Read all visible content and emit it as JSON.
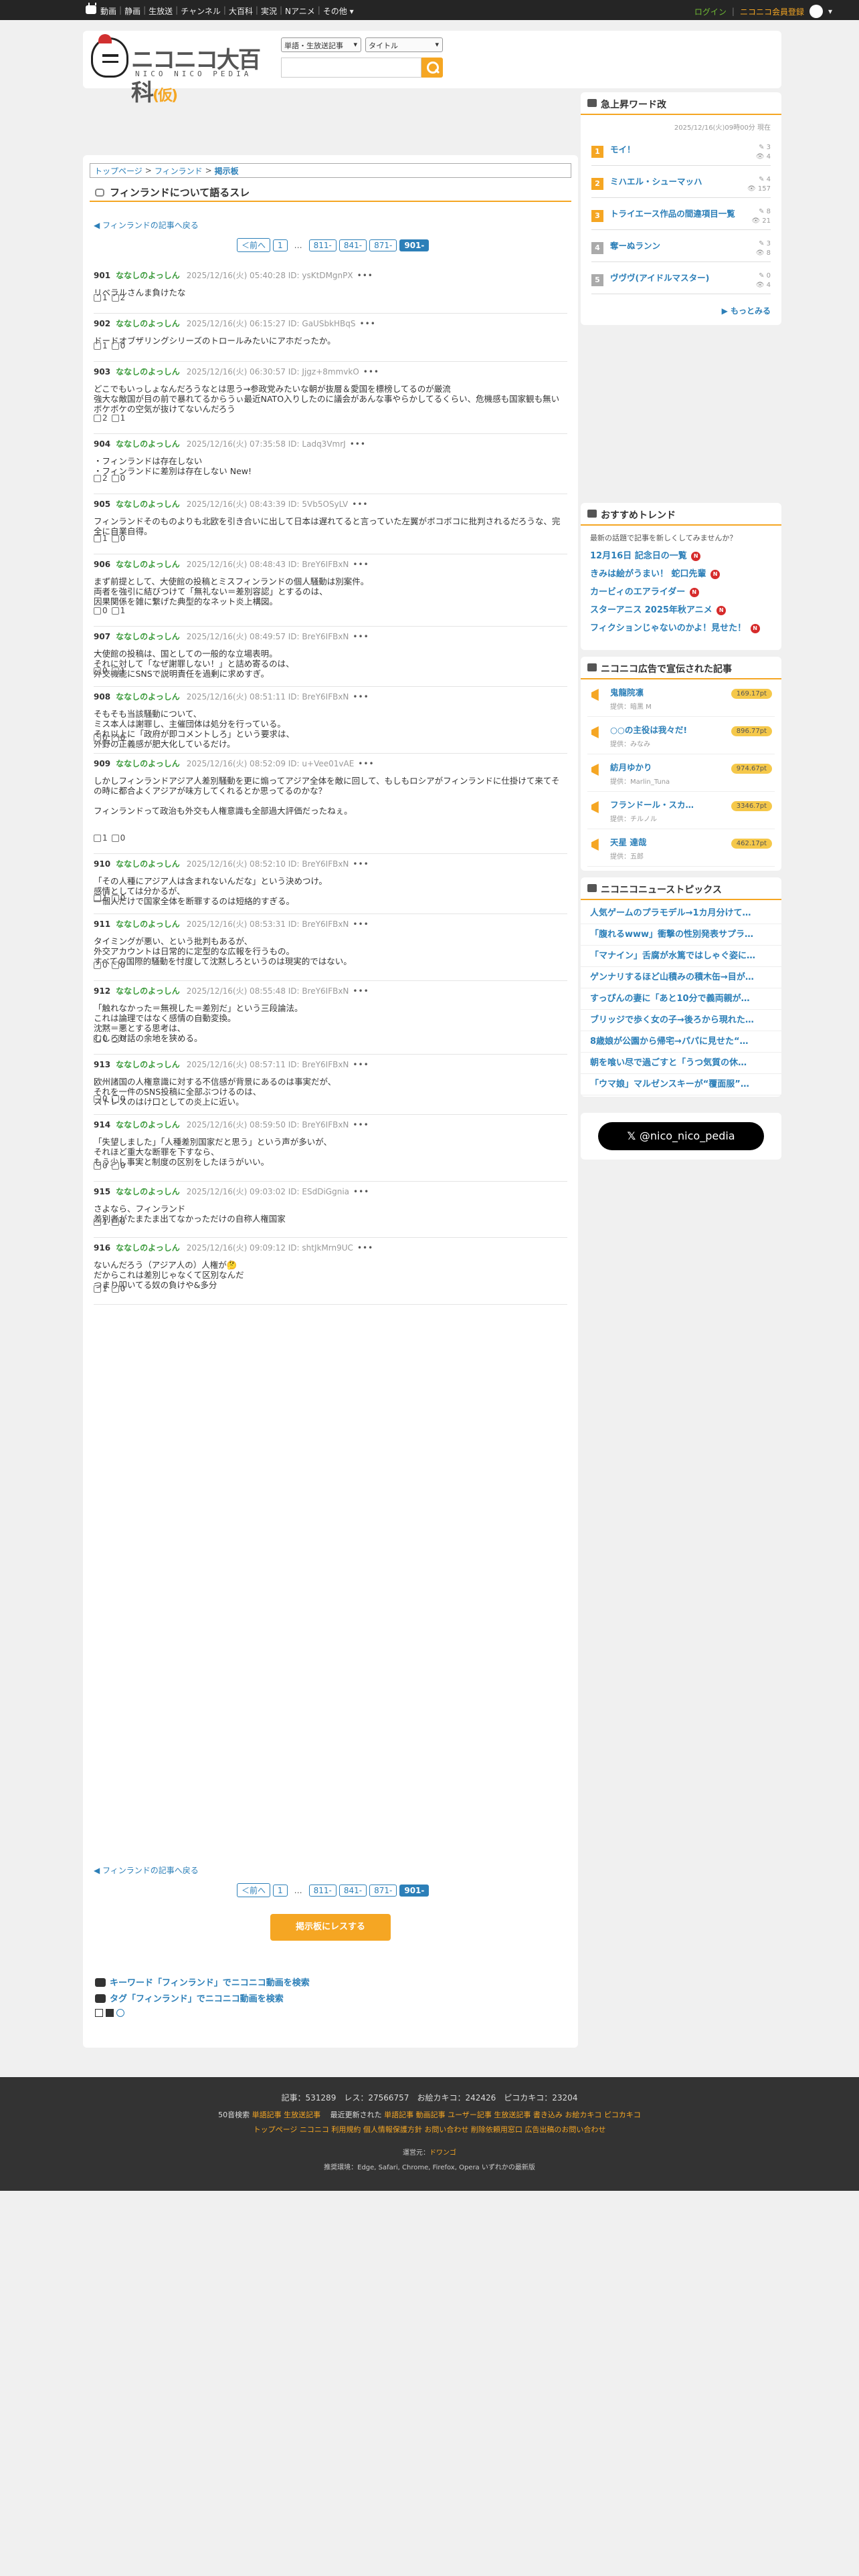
{
  "topbar": {
    "nav": [
      "動画",
      "静画",
      "生放送",
      "チャンネル",
      "大百科",
      "実況",
      "Nアニメ",
      "その他 ▾"
    ],
    "login": "ログイン",
    "register": "ニコニコ会員登録"
  },
  "header": {
    "logo_title": "ニコニコ大百科",
    "logo_badge": "(仮)",
    "logo_sub": "NICO NICO PEDIA",
    "search_type": "単語・生放送記事",
    "search_target": "タイトル",
    "search_placeholder": ""
  },
  "breadcrumb": [
    "トップページ",
    "フィンランド",
    "掲示板"
  ],
  "page_title": "フィンランドについて語るスレ",
  "back_link": "フィンランドの記事へ戻る",
  "pager": [
    "＜前へ",
    "1",
    "…",
    "811-",
    "841-",
    "871-",
    "901-"
  ],
  "posts": [
    {
      "no": "901",
      "name": "ななしのよっしん",
      "meta": "2025/12/16(火) 05:40:28 ID: ysKtDMgnPX",
      "body": "リベラルさんま負けたな",
      "good": "1",
      "bad": "2"
    },
    {
      "no": "902",
      "name": "ななしのよっしん",
      "meta": "2025/12/16(火) 06:15:27 ID: GaUSbkHBqS",
      "body": "ドードオブザリングシリーズのトロールみたいにアホだったか。",
      "good": "1",
      "bad": "0"
    },
    {
      "no": "903",
      "name": "ななしのよっしん",
      "meta": "2025/12/16(火) 06:30:57 ID: Jjgz+8mmvkO",
      "body": "どこでもいっしょなんだろうなとは思う→参政党みたいな朝が抜層＆愛国を標榜してるのが厳流\n強大な敵国が目の前で暴れてるからうぃ最近NATO入りしたのに議会があんな事やらかしてるくらい、危機感も国家観も無いボケボケの空気が抜けてないんだろう",
      "good": "2",
      "bad": "1"
    },
    {
      "no": "904",
      "name": "ななしのよっしん",
      "meta": "2025/12/16(火) 07:35:58 ID: Ladq3VmrJ",
      "body": "・フィンランドは存在しない\n・フィンランドに差別は存在しない New!",
      "good": "2",
      "bad": "0"
    },
    {
      "no": "905",
      "name": "ななしのよっしん",
      "meta": "2025/12/16(火) 08:43:39 ID: 5Vb5OSyLV",
      "body": "フィンランドそのものよりも北欧を引き合いに出して日本は遅れてると言っていた左翼がボコボコに批判されるだろうな、完全に自業自得。",
      "good": "1",
      "bad": "0"
    },
    {
      "no": "906",
      "name": "ななしのよっしん",
      "meta": "2025/12/16(火) 08:48:43 ID: BreY6IFBxN",
      "body": "まず前提として、大使館の投稿とミスフィンランドの個人騒動は別案件。\n両者を強引に結びつけて「無礼ない＝差別容認」とするのは、\n因果関係を雑に繋げた典型的なネット炎上構図。",
      "good": "0",
      "bad": "1"
    },
    {
      "no": "907",
      "name": "ななしのよっしん",
      "meta": "2025/12/16(火) 08:49:57 ID: BreY6IFBxN",
      "body": "大使館の投稿は、国としての一般的な立場表明。\nそれに対して「なぜ謝罪しない！」と詰め寄るのは、\n外交機能にSNSで説明責任を過剰に求めすぎ。",
      "good": "0",
      "bad": "1"
    },
    {
      "no": "908",
      "name": "ななしのよっしん",
      "meta": "2025/12/16(火) 08:51:11 ID: BreY6IFBxN",
      "body": "そもそも当該騒動について、\nミス本人は謝罪し、主催団体は処分を行っている。\nそれ以上に「政府が即コメントしろ」という要求は、\n外野の正義感が肥大化しているだけ。",
      "good": "0",
      "bad": "0"
    },
    {
      "no": "909",
      "name": "ななしのよっしん",
      "meta": "2025/12/16(火) 08:52:09 ID: u+Vee01vAE",
      "body": "しかしフィンランドアジア人差別騒動を更に煽ってアジア全体を敵に回して、もしもロシアがフィンランドに仕掛けて来てその時に都合よくアジアが味方してくれるとか思ってるのかな？\n\nフィンランドって政治も外交も人権意識も全部過大評価だったねぇ。",
      "good": "1",
      "bad": "0"
    },
    {
      "no": "910",
      "name": "ななしのよっしん",
      "meta": "2025/12/16(火) 08:52:10 ID: BreY6IFBxN",
      "body": "「その人種にアジア人は含まれないんだな」という決めつけ。\n感情としては分かるが、\n一個人だけで国家全体を断罪するのは短絡的すぎる。",
      "good": "1",
      "bad": "0"
    },
    {
      "no": "911",
      "name": "ななしのよっしん",
      "meta": "2025/12/16(火) 08:53:31 ID: BreY6IFBxN",
      "body": "タイミングが悪い、という批判もあるが、\n外交アカウントは日常的に定型的な広報を行うもの。\nすべての国際的騒動を忖度して沈黙しろというのは現実的ではない。",
      "good": "0",
      "bad": "0"
    },
    {
      "no": "912",
      "name": "ななしのよっしん",
      "meta": "2025/12/16(火) 08:55:48 ID: BreY6IFBxN",
      "body": "「触れなかった＝無視した＝差別だ」という三段論法。\nこれは論理ではなく感情の自動変換。\n沈黙＝悪とする思考は、\nむしろ対話の余地を狭める。",
      "good": "0",
      "bad": "0"
    },
    {
      "no": "913",
      "name": "ななしのよっしん",
      "meta": "2025/12/16(火) 08:57:11 ID: BreY6IFBxN",
      "body": "欧州諸国の人権意識に対する不信感が背景にあるのは事実だが、\nそれを一件のSNS投稿に全部ぶつけるのは、\nストレスのはけ口としての炎上に近い。",
      "good": "0",
      "bad": "0"
    },
    {
      "no": "914",
      "name": "ななしのよっしん",
      "meta": "2025/12/16(火) 08:59:50 ID: BreY6IFBxN",
      "body": "「失望しました」「人種差別国家だと思う」という声が多いが、\nそれほど重大な断罪を下すなら、\nもう少し事実と制度の区別をしたほうがいい。",
      "good": "0",
      "bad": "0"
    },
    {
      "no": "915",
      "name": "ななしのよっしん",
      "meta": "2025/12/16(火) 09:03:02 ID: ESdDiGgnia",
      "body": "さよなら、フィンランド\n差別者がたまたま出てなかっただけの自称人権国家",
      "good": "1",
      "bad": "0"
    },
    {
      "no": "916",
      "name": "ななしのよっしん",
      "meta": "2025/12/16(火) 09:09:12 ID: shtJkMrn9UC",
      "body": "ないんだろう（アジア人の）人権が🤔\nだからこれは差別じゃなくて区別なんだ\nつまり叩いてる奴の負けや&多分",
      "good": "1",
      "bad": "0"
    }
  ],
  "display_button": "掲示板にレスする",
  "keyword_links": [
    "キーワード「フィンランド」でニコニコ動画を検索",
    "タグ「フィンランド」でニコニコ動画を検索"
  ],
  "sidebar": {
    "rising_title": "急上昇ワード改",
    "rising_date": "2025/12/16(火)09時00分 現在",
    "rising": [
      {
        "no": "1",
        "title": "モイ！",
        "c1": "3",
        "c2": "4"
      },
      {
        "no": "2",
        "title": "ミハエル・シューマッハ",
        "c1": "4",
        "c2": "157"
      },
      {
        "no": "3",
        "title": "トライエース作品の間違項目一覧",
        "c1": "8",
        "c2": "21"
      },
      {
        "no": "4",
        "title": "奪ーぬランン",
        "c1": "3",
        "c2": "8"
      },
      {
        "no": "5",
        "title": "ヴヴヴ(アイドルマスター)",
        "c1": "0",
        "c2": "4"
      }
    ],
    "rising_more": "もっとみる",
    "trend_title": "おすすめトレンド",
    "trend_q": "最新の話題で記事を新しくしてみませんか？",
    "trends": [
      "12月16日 記念日の一覧",
      "きみは絵がうまい！ 蛇口先輩",
      "カービィのエアライダー",
      "スターアニス 2025年秋アニメ",
      "フィクションじゃないのかよ！見せた！"
    ],
    "ads_title": "ニコニコ広告で宣伝された記事",
    "ads": [
      {
        "title": "鬼龍院凛",
        "by": "提供：暗黒 M",
        "pt": "169.17pt"
      },
      {
        "title": "○○の主役は我々だ!",
        "by": "提供：みなみ",
        "pt": "896.77pt"
      },
      {
        "title": "紡月ゆかり",
        "by": "提供：Marlin_Tuna",
        "pt": "974.67pt"
      },
      {
        "title": "フランドール・スカ…",
        "by": "提供：チルノル",
        "pt": "3346.7pt"
      },
      {
        "title": "天星 達哉",
        "by": "提供：五郎",
        "pt": "462.17pt"
      }
    ],
    "news_title": "ニコニコニューストピックス",
    "news": [
      "人気ゲームのプラモデル→1カ月分けて…",
      "「腹れるwww」衝撃の性別発表サプラ…",
      "「マナイン」舌腐が水篤ではしゃぐ姿に…",
      "ゲンナリするほど山積みの積木缶→目が…",
      "すっぴんの妻に「あと10分で義両親が…",
      "ブリッジで歩く女の子→後ろから現れた…",
      "8歳娘が公園から帰宅→パパに見せた“…",
      "朝を喰い尽で過ごすと「うつ気質の休…",
      "「ウマ娘」マルゼンスキーが“覆面服”…"
    ],
    "x_label": "@nico_nico_pedia"
  },
  "footer": {
    "stats": [
      "記事：531289",
      "レス：27566757",
      "お絵カキコ：242426",
      "ピコカキコ：23204"
    ],
    "line2_label": "50音検索",
    "line2_links": [
      "単語記事",
      "生放送記事"
    ],
    "line2_label2": "最近更新された",
    "line2_links2": [
      "単語記事",
      "動画記事",
      "ユーザー記事",
      "生放送記事",
      "書き込み",
      "お絵カキコ",
      "ピコカキコ"
    ],
    "line3": [
      "トップページ",
      "ニコニコ",
      "利用規約",
      "個人情報保護方針",
      "お問い合わせ",
      "削除依頼用窓口",
      "広告出稿のお問い合わせ"
    ],
    "operator_label": "運営元：",
    "operator": "ドワンゴ",
    "env": "推奨環境：Edge, Safari, Chrome, Firefox, Opera いずれかの最新版"
  }
}
